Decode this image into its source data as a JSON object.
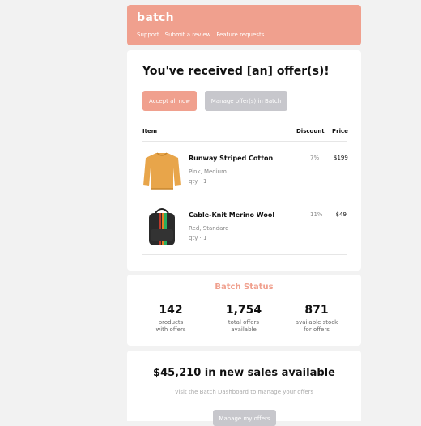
{
  "header": {
    "logo": "batch",
    "nav": [
      "Support",
      "Submit a review",
      "Feature requests"
    ]
  },
  "offers": {
    "headline": "You've received [an] offer(s)!",
    "accept_label": "Accept all now",
    "manage_label": "Manage offer(s) in Batch",
    "columns": {
      "item": "Item",
      "discount": "Discount",
      "price": "Price"
    },
    "items": [
      {
        "name": "Runway Striped Cotton",
        "variant": "Pink, Medium",
        "qty": "qty · 1",
        "discount": "7%",
        "price": "$199",
        "image_icon": "orange-sweater-icon"
      },
      {
        "name": "Cable-Knit Merino Wool",
        "variant": "Red, Standard",
        "qty": "qty · 1",
        "discount": "11%",
        "price": "$49",
        "image_icon": "striped-backpack-icon"
      }
    ]
  },
  "status": {
    "title": "Batch Status",
    "stats": [
      {
        "value": "142",
        "label1": "products",
        "label2": "with offers"
      },
      {
        "value": "1,754",
        "label1": "total offers",
        "label2": "available"
      },
      {
        "value": "871",
        "label1": "available stock",
        "label2": "for offers"
      }
    ]
  },
  "sales": {
    "headline": "$45,210 in new sales available",
    "subtext": "Visit the Batch Dashboard to manage your offers",
    "button_label": "Manage my offers"
  },
  "colors": {
    "accent": "#f0a08e",
    "button_gray": "#c7c7cc",
    "background": "#f2f2f2"
  }
}
